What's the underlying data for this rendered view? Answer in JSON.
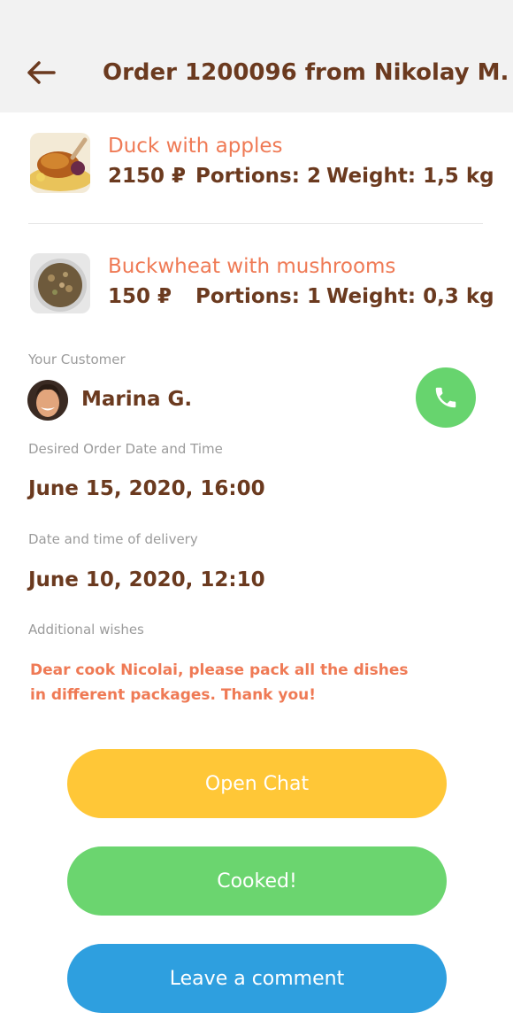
{
  "header": {
    "title": "Order 1200096 from Nikolay M."
  },
  "dishes": [
    {
      "name": "Duck with apples",
      "price": "2150 ₽",
      "portions": "Portions: 2",
      "weight": "Weight: 1,5 kg",
      "image": "roast-duck-icon"
    },
    {
      "name": "Buckwheat with mushrooms",
      "price": "150 ₽",
      "portions": "Portions: 1",
      "weight": "Weight: 0,3 kg",
      "image": "buckwheat-bowl-icon"
    }
  ],
  "customer": {
    "label": "Your Customer",
    "name": "Marina G."
  },
  "desired": {
    "label": "Desired Order Date and Time",
    "value": "June 15, 2020, 16:00"
  },
  "delivery": {
    "label": "Date and time of delivery",
    "value": "June 10, 2020, 12:10"
  },
  "wishes": {
    "label": "Additional wishes",
    "line1": "Dear cook Nicolai, please pack all the dishes",
    "line2": "in different packages. Thank you!"
  },
  "buttons": {
    "chat": "Open Chat",
    "cooked": "Cooked!",
    "comment": "Leave a comment"
  },
  "colors": {
    "accent_brown": "#6b3a1f",
    "accent_orange": "#ef7a55",
    "chat_yellow": "#ffc737",
    "cooked_green": "#6bd56f",
    "comment_blue": "#2e9fdf",
    "call_green": "#67d46e"
  }
}
